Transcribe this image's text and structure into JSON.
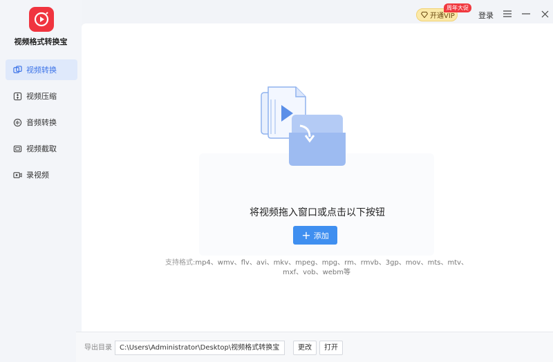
{
  "app": {
    "title": "视频格式转换宝"
  },
  "sidebar": {
    "items": [
      {
        "label": "视频转换",
        "icon": "video-convert-icon",
        "active": true
      },
      {
        "label": "视频压缩",
        "icon": "compress-icon",
        "active": false
      },
      {
        "label": "音频转换",
        "icon": "audio-icon",
        "active": false
      },
      {
        "label": "视频截取",
        "icon": "cut-icon",
        "active": false
      },
      {
        "label": "录视频",
        "icon": "record-icon",
        "active": false
      }
    ]
  },
  "topbar": {
    "vip_label": "开通VIP",
    "vip_badge": "周年大促",
    "login_label": "登录"
  },
  "main": {
    "drop_text": "将视频拖入窗口或点击以下按钮",
    "add_label": "添加",
    "formats_label": "支持格式:",
    "formats_line1": "mp4、wmv、flv、avi、mkv、mpeg、mpg、rm、rmvb、3gp、mov、mts、mtv、",
    "formats_line2": "mxf、vob、webm等"
  },
  "bottom": {
    "output_label": "导出目录",
    "output_path": "C:\\Users\\Administrator\\Desktop\\视频格式转换宝",
    "change_label": "更改",
    "open_label": "打开"
  },
  "colors": {
    "accent": "#3f8ff0",
    "brand": "#f0343f",
    "active_nav_bg": "#dfe9fb"
  }
}
